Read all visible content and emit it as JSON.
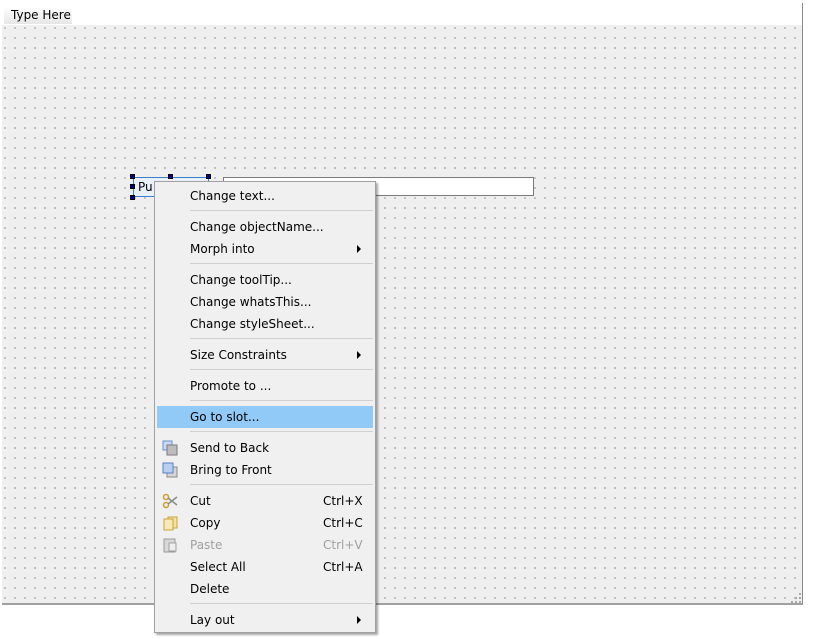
{
  "menubar": {
    "type_here": "Type Here"
  },
  "form": {
    "button_text": "Pu",
    "line_edit_value": ""
  },
  "context_menu": {
    "items": [
      {
        "label": "Change text..."
      },
      {
        "label": "Change objectName..."
      },
      {
        "label": "Morph into",
        "submenu": true
      },
      {
        "label": "Change toolTip..."
      },
      {
        "label": "Change whatsThis..."
      },
      {
        "label": "Change styleSheet..."
      },
      {
        "label": "Size Constraints",
        "submenu": true
      },
      {
        "label": "Promote to ..."
      },
      {
        "label": "Go to slot...",
        "highlighted": true
      },
      {
        "label": "Send to Back",
        "icon": "send-to-back-icon"
      },
      {
        "label": "Bring to Front",
        "icon": "bring-to-front-icon"
      },
      {
        "label": "Cut",
        "shortcut": "Ctrl+X",
        "icon": "scissors-icon"
      },
      {
        "label": "Copy",
        "shortcut": "Ctrl+C",
        "icon": "copy-icon"
      },
      {
        "label": "Paste",
        "shortcut": "Ctrl+V",
        "icon": "paste-icon",
        "disabled": true
      },
      {
        "label": "Select All",
        "shortcut": "Ctrl+A"
      },
      {
        "label": "Delete"
      },
      {
        "label": "Lay out",
        "submenu": true
      }
    ]
  },
  "colors": {
    "highlight": "#91c9f7",
    "selection_handle": "#000080"
  }
}
